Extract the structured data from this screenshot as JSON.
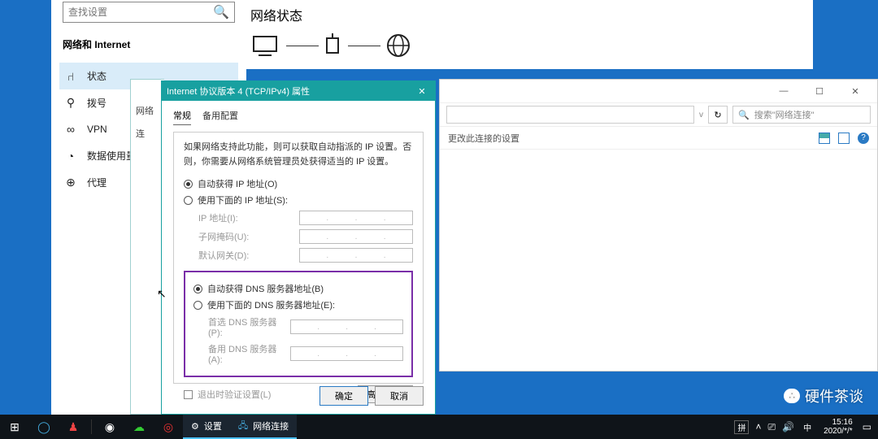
{
  "settings": {
    "search_placeholder": "查找设置",
    "category": "网络和 Internet",
    "items": [
      {
        "icon": "⑁",
        "label": "状态"
      },
      {
        "icon": "⚲",
        "label": "拨号"
      },
      {
        "icon": "∞",
        "label": "VPN"
      },
      {
        "icon": "◔",
        "label": "数据使用量"
      },
      {
        "icon": "⊕",
        "label": "代理"
      }
    ],
    "main_title": "网络状态"
  },
  "explorer": {
    "search_placeholder": "搜索\"网络连接\"",
    "toolbar_text": "更改此连接的设置",
    "refresh_icon": "↻",
    "dropdown_icon": "v",
    "help_icon": "?",
    "min": "—",
    "max": "☐",
    "close": "✕"
  },
  "under": {
    "row1": "网络",
    "row2": "连"
  },
  "dialog": {
    "title": "Internet 协议版本 4 (TCP/IPv4) 属性",
    "close": "✕",
    "tabs": {
      "general": "常规",
      "alt": "备用配置"
    },
    "desc": "如果网络支持此功能，则可以获取自动指派的 IP 设置。否则，你需要从网络系统管理员处获得适当的 IP 设置。",
    "ip_auto": "自动获得 IP 地址(O)",
    "ip_manual": "使用下面的 IP 地址(S):",
    "ip_addr_label": "IP 地址(I):",
    "subnet_label": "子网掩码(U):",
    "gateway_label": "默认网关(D):",
    "dns_auto": "自动获得 DNS 服务器地址(B)",
    "dns_manual": "使用下面的 DNS 服务器地址(E):",
    "dns_pref_label": "首选 DNS 服务器(P):",
    "dns_alt_label": "备用 DNS 服务器(A):",
    "validate_label": "退出时验证设置(L)",
    "advanced": "高级(V)...",
    "ok": "确定",
    "cancel": "取消"
  },
  "watermark": {
    "text": "硬件茶谈"
  },
  "taskbar": {
    "start": "⊞",
    "settings_label": "设置",
    "app_label": "网络连接",
    "ime": "拼",
    "ime2": "中",
    "time": "15:16",
    "date": "2020/*/*",
    "tray_up": "˄",
    "tray_net": "⎚",
    "tray_vol": "🔊",
    "notif": "▭"
  }
}
